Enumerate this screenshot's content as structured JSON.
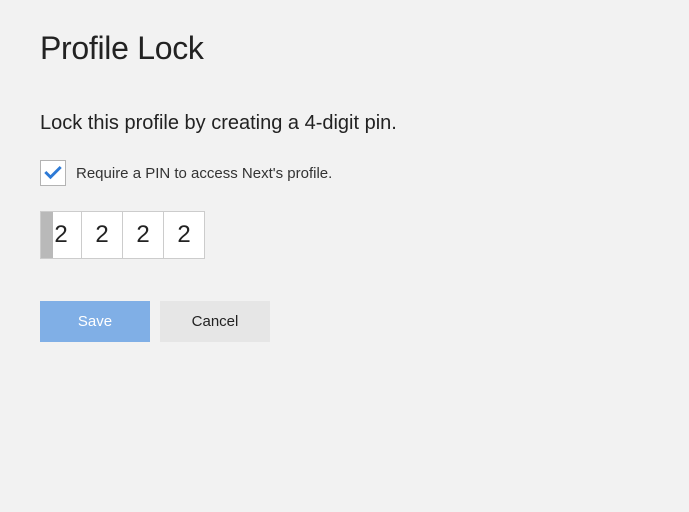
{
  "title": "Profile Lock",
  "subtitle": "Lock this profile by creating a 4-digit pin.",
  "checkbox": {
    "checked": true,
    "label": "Require a PIN to access Next's profile."
  },
  "pin": {
    "digits": [
      "2",
      "2",
      "2",
      "2"
    ],
    "activeIndex": 0
  },
  "buttons": {
    "save": "Save",
    "cancel": "Cancel"
  }
}
